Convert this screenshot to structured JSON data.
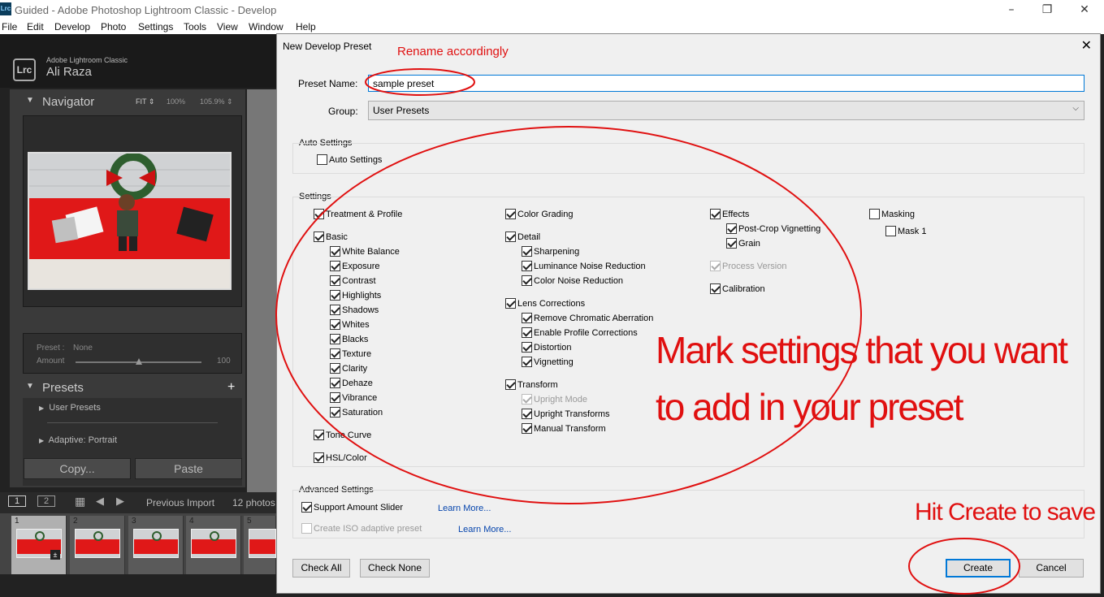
{
  "window": {
    "app_icon": "Lrc",
    "title": "Guided - Adobe Photoshop Lightroom Classic - Develop",
    "controls": {
      "minimize": "–",
      "maximize": "❐",
      "close": "✕"
    }
  },
  "menubar": [
    "File",
    "Edit",
    "Develop",
    "Photo",
    "Settings",
    "Tools",
    "View",
    "Window",
    "Help"
  ],
  "lightroom": {
    "logo": "Lrc",
    "app_name": "Adobe Lightroom Classic",
    "user": "Ali Raza",
    "navigator": {
      "title": "Navigator",
      "fit": "FIT ⇕",
      "z1": "100%",
      "z2": "105.9% ⇕"
    },
    "preset_panel": {
      "preset_label": "Preset :",
      "preset_value": "None",
      "amount_label": "Amount",
      "amount_value": "100",
      "amount_fraction": 0.5
    },
    "presets": {
      "title": "Presets",
      "add": "+",
      "items": [
        "User Presets",
        "Adaptive: Portrait"
      ]
    },
    "copy": "Copy...",
    "paste": "Paste",
    "filmstrip": {
      "page1": "1",
      "page2": "2",
      "source": "Previous Import",
      "count": "12 photos",
      "thumb_numbers": [
        "1",
        "2",
        "3",
        "4",
        "5"
      ]
    }
  },
  "dialog": {
    "title": "New Develop Preset",
    "close": "✕",
    "preset_name_label": "Preset Name:",
    "preset_name_value": "sample preset",
    "group_label": "Group:",
    "group_value": "User Presets",
    "group_arrow": "⌵",
    "auto_settings": {
      "title": "Auto Settings",
      "items": [
        {
          "label": "Auto Settings",
          "checked": false
        }
      ]
    },
    "settings": {
      "title": "Settings",
      "col1": [
        {
          "label": "Treatment & Profile",
          "checked": true,
          "indent": 0,
          "disabled": false
        },
        {
          "label": "Basic",
          "checked": true,
          "indent": 0,
          "disabled": false
        },
        {
          "label": "White Balance",
          "checked": true,
          "indent": 1,
          "disabled": false
        },
        {
          "label": "Exposure",
          "checked": true,
          "indent": 1,
          "disabled": false
        },
        {
          "label": "Contrast",
          "checked": true,
          "indent": 1,
          "disabled": false
        },
        {
          "label": "Highlights",
          "checked": true,
          "indent": 1,
          "disabled": false
        },
        {
          "label": "Shadows",
          "checked": true,
          "indent": 1,
          "disabled": false
        },
        {
          "label": "Whites",
          "checked": true,
          "indent": 1,
          "disabled": false
        },
        {
          "label": "Blacks",
          "checked": true,
          "indent": 1,
          "disabled": false
        },
        {
          "label": "Texture",
          "checked": true,
          "indent": 1,
          "disabled": false
        },
        {
          "label": "Clarity",
          "checked": true,
          "indent": 1,
          "disabled": false
        },
        {
          "label": "Dehaze",
          "checked": true,
          "indent": 1,
          "disabled": false
        },
        {
          "label": "Vibrance",
          "checked": true,
          "indent": 1,
          "disabled": false
        },
        {
          "label": "Saturation",
          "checked": true,
          "indent": 1,
          "disabled": false
        },
        {
          "label": "Tone Curve",
          "checked": true,
          "indent": 0,
          "disabled": false
        },
        {
          "label": "HSL/Color",
          "checked": true,
          "indent": 0,
          "disabled": false
        }
      ],
      "col2": [
        {
          "label": "Color Grading",
          "checked": true,
          "indent": 0,
          "disabled": false
        },
        {
          "label": "Detail",
          "checked": true,
          "indent": 0,
          "disabled": false
        },
        {
          "label": "Sharpening",
          "checked": true,
          "indent": 1,
          "disabled": false
        },
        {
          "label": "Luminance Noise Reduction",
          "checked": true,
          "indent": 1,
          "disabled": false
        },
        {
          "label": "Color Noise Reduction",
          "checked": true,
          "indent": 1,
          "disabled": false
        },
        {
          "label": "Lens Corrections",
          "checked": true,
          "indent": 0,
          "disabled": false
        },
        {
          "label": "Remove Chromatic Aberration",
          "checked": true,
          "indent": 1,
          "disabled": false
        },
        {
          "label": "Enable Profile Corrections",
          "checked": true,
          "indent": 1,
          "disabled": false
        },
        {
          "label": "Distortion",
          "checked": true,
          "indent": 1,
          "disabled": false
        },
        {
          "label": "Vignetting",
          "checked": true,
          "indent": 1,
          "disabled": false
        },
        {
          "label": "Transform",
          "checked": true,
          "indent": 0,
          "disabled": false
        },
        {
          "label": "Upright Mode",
          "checked": true,
          "indent": 1,
          "disabled": true
        },
        {
          "label": "Upright Transforms",
          "checked": true,
          "indent": 1,
          "disabled": false
        },
        {
          "label": "Manual Transform",
          "checked": true,
          "indent": 1,
          "disabled": false
        }
      ],
      "col3": [
        {
          "label": "Effects",
          "checked": true,
          "indent": 0,
          "disabled": false
        },
        {
          "label": "Post-Crop Vignetting",
          "checked": true,
          "indent": 1,
          "disabled": false
        },
        {
          "label": "Grain",
          "checked": true,
          "indent": 1,
          "disabled": false
        },
        {
          "label": "Process Version",
          "checked": true,
          "indent": 0,
          "disabled": true
        },
        {
          "label": "Calibration",
          "checked": true,
          "indent": 0,
          "disabled": false
        }
      ],
      "col4": [
        {
          "label": "Masking",
          "checked": false,
          "indent": 0,
          "disabled": false
        },
        {
          "label": "Mask 1",
          "checked": false,
          "indent": 1,
          "disabled": false
        }
      ]
    },
    "advanced": {
      "title": "Advanced Settings",
      "items": [
        {
          "label": "Support Amount Slider",
          "checked": true,
          "disabled": false,
          "link": "Learn More..."
        },
        {
          "label": "Create ISO adaptive preset",
          "checked": false,
          "disabled": true,
          "link": "Learn More..."
        }
      ]
    },
    "buttons": {
      "check_all": "Check All",
      "check_none": "Check None",
      "create": "Create",
      "cancel": "Cancel"
    }
  },
  "annotations": {
    "rename": "Rename accordingly",
    "mark_line1": "Mark settings that you want",
    "mark_line2": "to add in your preset",
    "hit_create": "Hit Create to save",
    "color": "#e01010"
  }
}
